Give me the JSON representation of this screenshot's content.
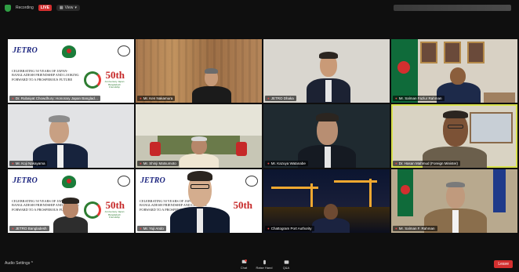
{
  "topbar": {
    "status_text": "Recording",
    "live_badge": "LIVE",
    "view_label": "View",
    "search_hint": ""
  },
  "tiles": [
    {
      "name": "Dr. Rubaiyat Chowdhury: Honorary Japan Banglad…",
      "kind": "slide"
    },
    {
      "name": "Mr. Ken Nakamura",
      "kind": "video"
    },
    {
      "name": "JETRO Dhaka",
      "kind": "video"
    },
    {
      "name": "Mr. Salman Fazlur Rahman",
      "kind": "video"
    },
    {
      "name": "Mr. Koji Nakayama",
      "kind": "video"
    },
    {
      "name": "Mr. Shinji Matsumoto",
      "kind": "video"
    },
    {
      "name": "Mr. Kazuya Watanabe",
      "kind": "video"
    },
    {
      "name": "Dr. Hasan Mahmud (Foreign Minister)",
      "kind": "video",
      "active": true
    },
    {
      "name": "JETRO Bangladesh",
      "kind": "slide"
    },
    {
      "name": "Mr. Yuji Ando",
      "kind": "slide-person"
    },
    {
      "name": "Chattogram Port Authority",
      "kind": "port"
    },
    {
      "name": "Mr. Salman F. Rahman",
      "kind": "video"
    }
  ],
  "slide": {
    "logo": "JETRO",
    "body": "Celebrating 50 years of Japan-Bangladesh Friendship and looking forward to a prosperous future",
    "fifty": "50th",
    "fifty_sub": "Anniversary Japan Bangladesh Friendship"
  },
  "bottombar": {
    "audio_label": "Audio Settings",
    "controls": [
      "Chat",
      "Raise Hand",
      "Q&A"
    ],
    "leave_label": "Leave"
  },
  "colors": {
    "background": "#0f0f0f",
    "active_outline": "#d7e04b",
    "record_red": "#d32f2f"
  }
}
